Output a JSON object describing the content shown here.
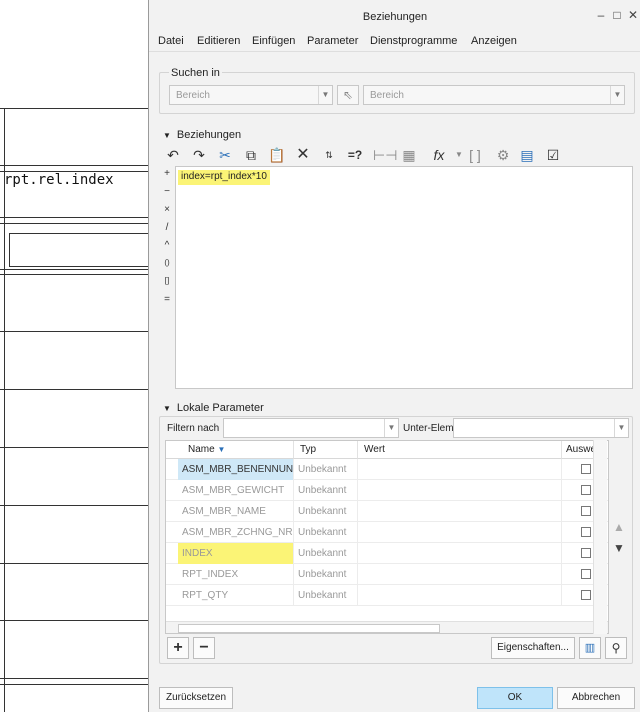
{
  "background_doc": {
    "cell_text": "rpt.rel.index"
  },
  "window": {
    "title": "Beziehungen",
    "minimize": "–",
    "maximize": "□",
    "close": "✕"
  },
  "menu": [
    "Datei",
    "Editieren",
    "Einfügen",
    "Parameter",
    "Dienstprogramme",
    "Anzeigen"
  ],
  "search": {
    "group_label": "Suchen in",
    "left_combo": "Bereich",
    "right_combo": "Bereich"
  },
  "relations": {
    "section_label": "Beziehungen",
    "toolbar_icons": [
      "undo-icon",
      "redo-icon",
      "cut-icon",
      "copy-icon",
      "paste-icon",
      "delete-icon",
      "sort-icon",
      "evaluate-icon",
      "measure-icon",
      "image-icon",
      "function-icon",
      "bracket-icon",
      "settings-icon",
      "display-icon",
      "verify-icon"
    ],
    "operators": [
      "+",
      "−",
      "×",
      "/",
      "^",
      "()",
      "[]",
      "="
    ],
    "text": "index=rpt_index*10"
  },
  "local_params": {
    "section_label": "Lokale Parameter",
    "filter_label": "Filtern nach",
    "filter_value": "",
    "sub_label": "Unter-Elem",
    "sub_value": "",
    "columns": [
      "Name",
      "Typ",
      "Wert",
      "Ausweis"
    ],
    "rows": [
      {
        "name": "ASM_MBR_BENENNUNG",
        "typ": "Unbekannt",
        "wert": "",
        "selected": true
      },
      {
        "name": "ASM_MBR_GEWICHT",
        "typ": "Unbekannt",
        "wert": ""
      },
      {
        "name": "ASM_MBR_NAME",
        "typ": "Unbekannt",
        "wert": ""
      },
      {
        "name": "ASM_MBR_ZCHNG_NR",
        "typ": "Unbekannt",
        "wert": ""
      },
      {
        "name": "INDEX",
        "typ": "Unbekannt",
        "wert": "",
        "highlighted": true
      },
      {
        "name": "RPT_INDEX",
        "typ": "Unbekannt",
        "wert": ""
      },
      {
        "name": "RPT_QTY",
        "typ": "Unbekannt",
        "wert": ""
      }
    ],
    "add": "+",
    "remove": "−",
    "properties_button": "Eigenschaften..."
  },
  "footer": {
    "reset": "Zurücksetzen",
    "ok": "OK",
    "cancel": "Abbrechen"
  },
  "colors": {
    "highlight": "#fbf476",
    "selection": "#cfe8f7",
    "ok_button": "#bfe4fa"
  }
}
